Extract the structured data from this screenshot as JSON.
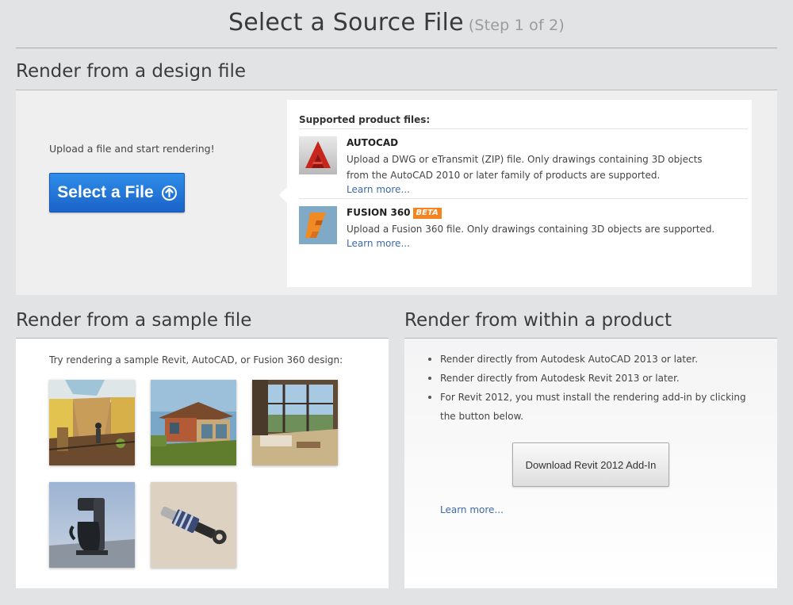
{
  "header": {
    "title": "Select a Source File",
    "step": "(Step 1 of 2)"
  },
  "design_section": {
    "title": "Render from a design file",
    "upload_text": "Upload a file and start rendering!",
    "select_button_label": "Select a File",
    "select_button_icon": "up-arrow-circle-icon",
    "supported_title": "Supported product files:",
    "products": [
      {
        "name": "AUTOCAD",
        "icon": "autocad-logo-icon",
        "description": "Upload a DWG or eTransmit (ZIP) file. Only drawings containing 3D objects from the AutoCAD 2010 or later family of products are supported.",
        "learn_more": "Learn more..."
      },
      {
        "name": "FUSION 360",
        "badge": "BETA",
        "icon": "fusion360-logo-icon",
        "description": "Upload a Fusion 360 file. Only drawings containing 3D objects are supported.",
        "learn_more": "Learn more..."
      }
    ]
  },
  "sample_section": {
    "title": "Render from a sample file",
    "intro": "Try rendering a sample Revit, AutoCAD, or Fusion 360 design:",
    "samples": [
      {
        "name": "atrium-interior"
      },
      {
        "name": "modern-house-exterior"
      },
      {
        "name": "living-room-interior"
      },
      {
        "name": "coffee-maker"
      },
      {
        "name": "shock-absorber"
      }
    ]
  },
  "within_section": {
    "title": "Render from within a product",
    "bullets": [
      "Render directly from Autodesk AutoCAD 2013 or later.",
      "Render directly from Autodesk Revit 2013 or later.",
      "For Revit 2012, you must install the rendering add-in by clicking the button below."
    ],
    "download_button_label": "Download Revit 2012 Add-In",
    "learn_more": "Learn more..."
  },
  "colors": {
    "page_background": "#e2e3e5",
    "primary_button": "#1f6fd6",
    "link": "#3e69a8",
    "beta_badge": "#f5831f",
    "autocad_red": "#c8251c"
  }
}
